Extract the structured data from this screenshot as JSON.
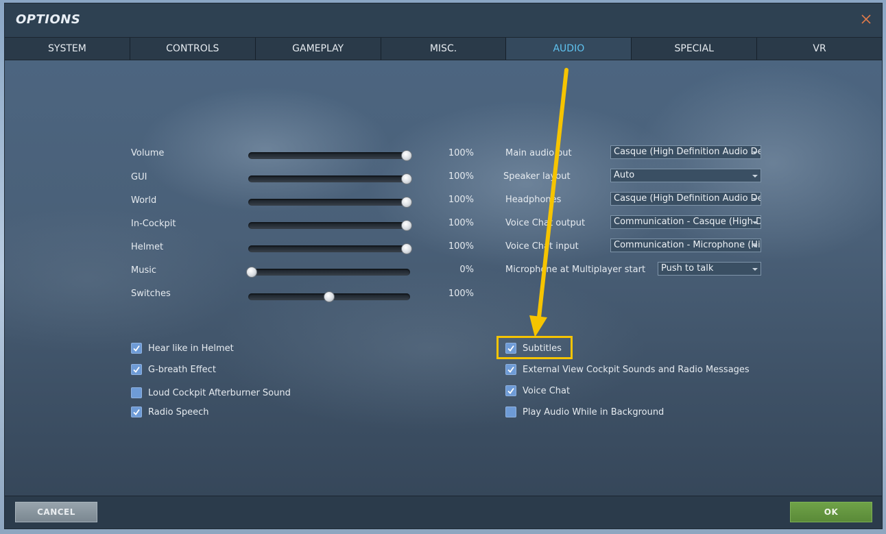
{
  "window": {
    "title": "OPTIONS",
    "close_icon": "close-icon"
  },
  "tabs": [
    {
      "label": "SYSTEM",
      "active": false
    },
    {
      "label": "CONTROLS",
      "active": false
    },
    {
      "label": "GAMEPLAY",
      "active": false
    },
    {
      "label": "MISC.",
      "active": false
    },
    {
      "label": "AUDIO",
      "active": true
    },
    {
      "label": "SPECIAL",
      "active": false
    },
    {
      "label": "VR",
      "active": false
    }
  ],
  "sliders": [
    {
      "label": "Volume",
      "value": 100,
      "display": "100%"
    },
    {
      "label": "GUI",
      "value": 100,
      "display": "100%"
    },
    {
      "label": "World",
      "value": 100,
      "display": "100%"
    },
    {
      "label": "In-Cockpit",
      "value": 100,
      "display": "100%"
    },
    {
      "label": "Helmet",
      "value": 100,
      "display": "100%"
    },
    {
      "label": "Music",
      "value": 0,
      "display": "0%"
    },
    {
      "label": "Switches",
      "value": 50,
      "display": "100%"
    }
  ],
  "selects": [
    {
      "label": "Main audio out",
      "value": "Casque (High Definition Audio Dev"
    },
    {
      "label": "Speaker layout",
      "value": "Auto"
    },
    {
      "label": "Headphones",
      "value": "Casque (High Definition Audio Dev"
    },
    {
      "label": "Voice Chat output",
      "value": "Communication - Casque (High De"
    },
    {
      "label": "Voice Chat input",
      "value": "Communication - Microphone (High"
    },
    {
      "label": "Microphone at Multiplayer start",
      "value": "Push to talk"
    }
  ],
  "checkboxes_left": [
    {
      "label": "Hear like in Helmet",
      "checked": true
    },
    {
      "label": "G-breath Effect",
      "checked": true
    },
    {
      "label": "Loud Cockpit Afterburner Sound",
      "checked": false
    },
    {
      "label": "Radio Speech",
      "checked": true
    }
  ],
  "checkboxes_right": [
    {
      "label": "Subtitles",
      "checked": true
    },
    {
      "label": "External View Cockpit Sounds and Radio Messages",
      "checked": true
    },
    {
      "label": "Voice Chat",
      "checked": true
    },
    {
      "label": "Play Audio While in Background",
      "checked": false
    }
  ],
  "footer": {
    "cancel_label": "CANCEL",
    "ok_label": "OK"
  },
  "colors": {
    "active_tab": "#5fc3f0",
    "highlight": "#f6c400",
    "ok_green": "#5f9140",
    "checkbox": "#6e9bd6"
  }
}
